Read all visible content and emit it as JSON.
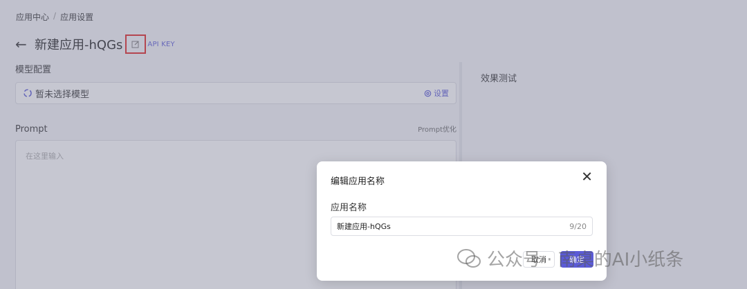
{
  "breadcrumb": {
    "home": "应用中心",
    "sep": "/",
    "current": "应用设置"
  },
  "header": {
    "back_icon": "arrow-left-icon",
    "title": "新建应用-hQGs",
    "edit_icon": "edit-icon",
    "api_key": "API KEY"
  },
  "model": {
    "section": "模型配置",
    "placeholder": "暂未选择模型",
    "settings": "设置"
  },
  "prompt": {
    "label": "Prompt",
    "optimize": "Prompt优化",
    "placeholder": "在这里输入"
  },
  "preview": {
    "label": "效果测试"
  },
  "modal": {
    "title": "编辑应用名称",
    "field_label": "应用名称",
    "value": "新建应用-hQGs",
    "counter": "9/20",
    "cancel": "取消",
    "confirm": "确定"
  },
  "watermark": {
    "text": "公众号 · 南桌的AI小纸条"
  },
  "colors": {
    "accent": "#5b5bd6",
    "highlight": "#e02020"
  }
}
